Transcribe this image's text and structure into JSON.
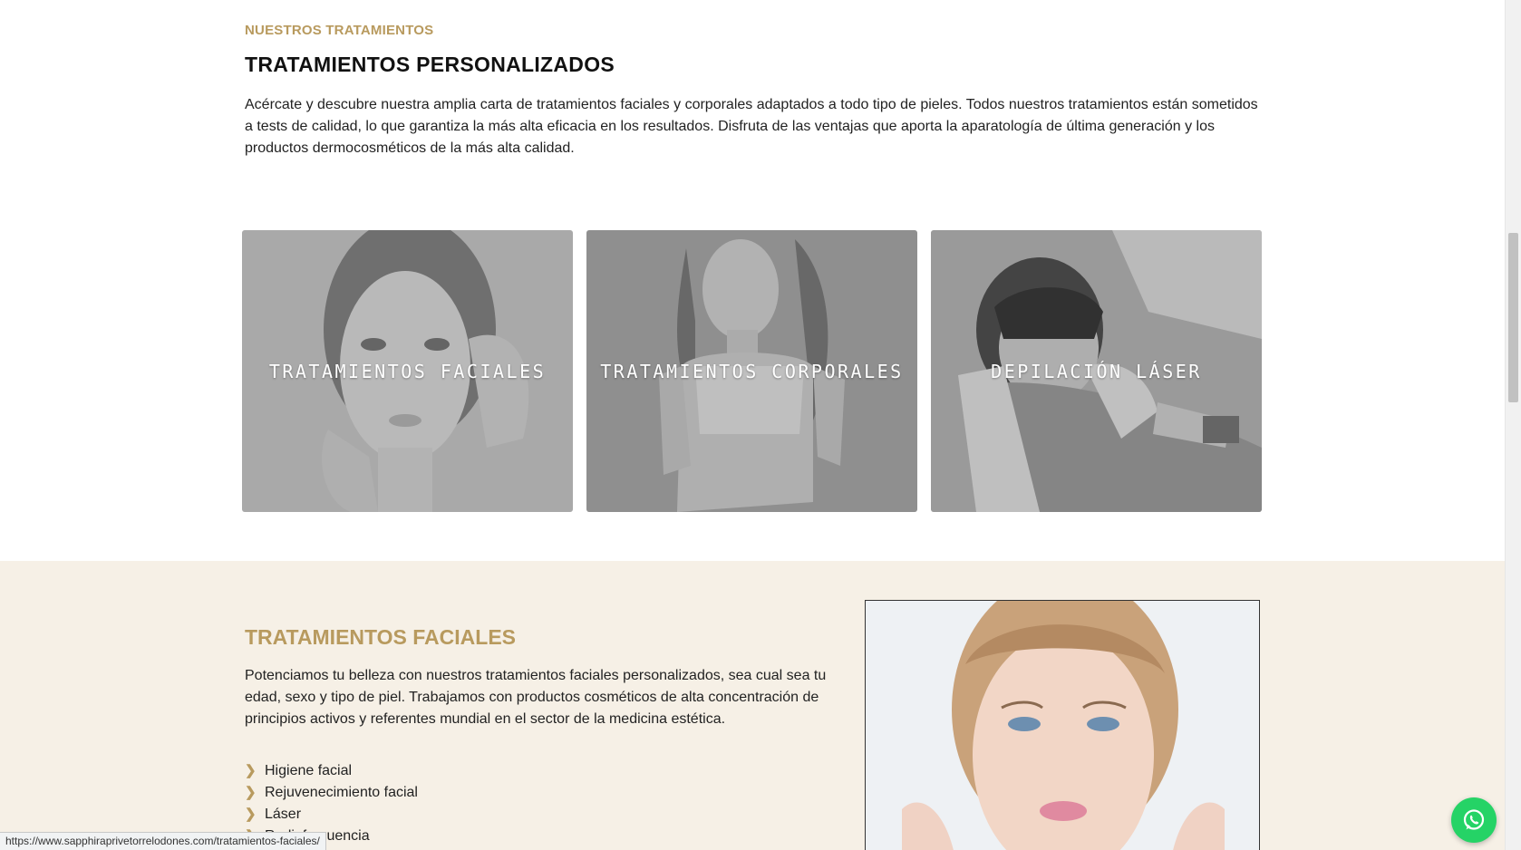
{
  "intro": {
    "eyebrow": "NUESTROS TRATAMIENTOS",
    "heading": "TRATAMIENTOS PERSONALIZADOS",
    "text": "Acércate y descubre nuestra amplia carta de tratamientos faciales y corporales adaptados a todo tipo de pieles. Todos nuestros tratamientos están sometidos a tests de calidad, lo que garantiza la más alta eficacia en los resultados. Disfruta de las ventajas que aporta la aparatología de última generación y los productos dermocosméticos de la más alta calidad."
  },
  "cards": [
    {
      "label": "TRATAMIENTOS FACIALES",
      "image": "woman-face-photo"
    },
    {
      "label": "TRATAMIENTOS CORPORALES",
      "image": "woman-body-photo"
    },
    {
      "label": "DEPILACIÓN LÁSER",
      "image": "laser-treatment-photo"
    }
  ],
  "facial": {
    "title": "TRATAMIENTOS FACIALES",
    "text": "Potenciamos tu belleza con nuestros tratamientos faciales personalizados, sea cual sea tu edad, sexo y tipo de piel. Trabajamos con productos cosméticos de alta concentración de principios activos y referentes mundial en el sector de la medicina estética.",
    "items": [
      "Higiene facial",
      "Rejuvenecimiento facial",
      "Láser",
      "Radiofrecuencia"
    ],
    "image": "woman-portrait-photo"
  },
  "status_url": "https://www.sapphiraprivetorrelodones.com/tratamientos-faciales/",
  "whatsapp_icon": "whatsapp-icon",
  "colors": {
    "accent": "#b89a5e",
    "section_bg": "#f6f0e6",
    "whatsapp": "#25d366"
  }
}
